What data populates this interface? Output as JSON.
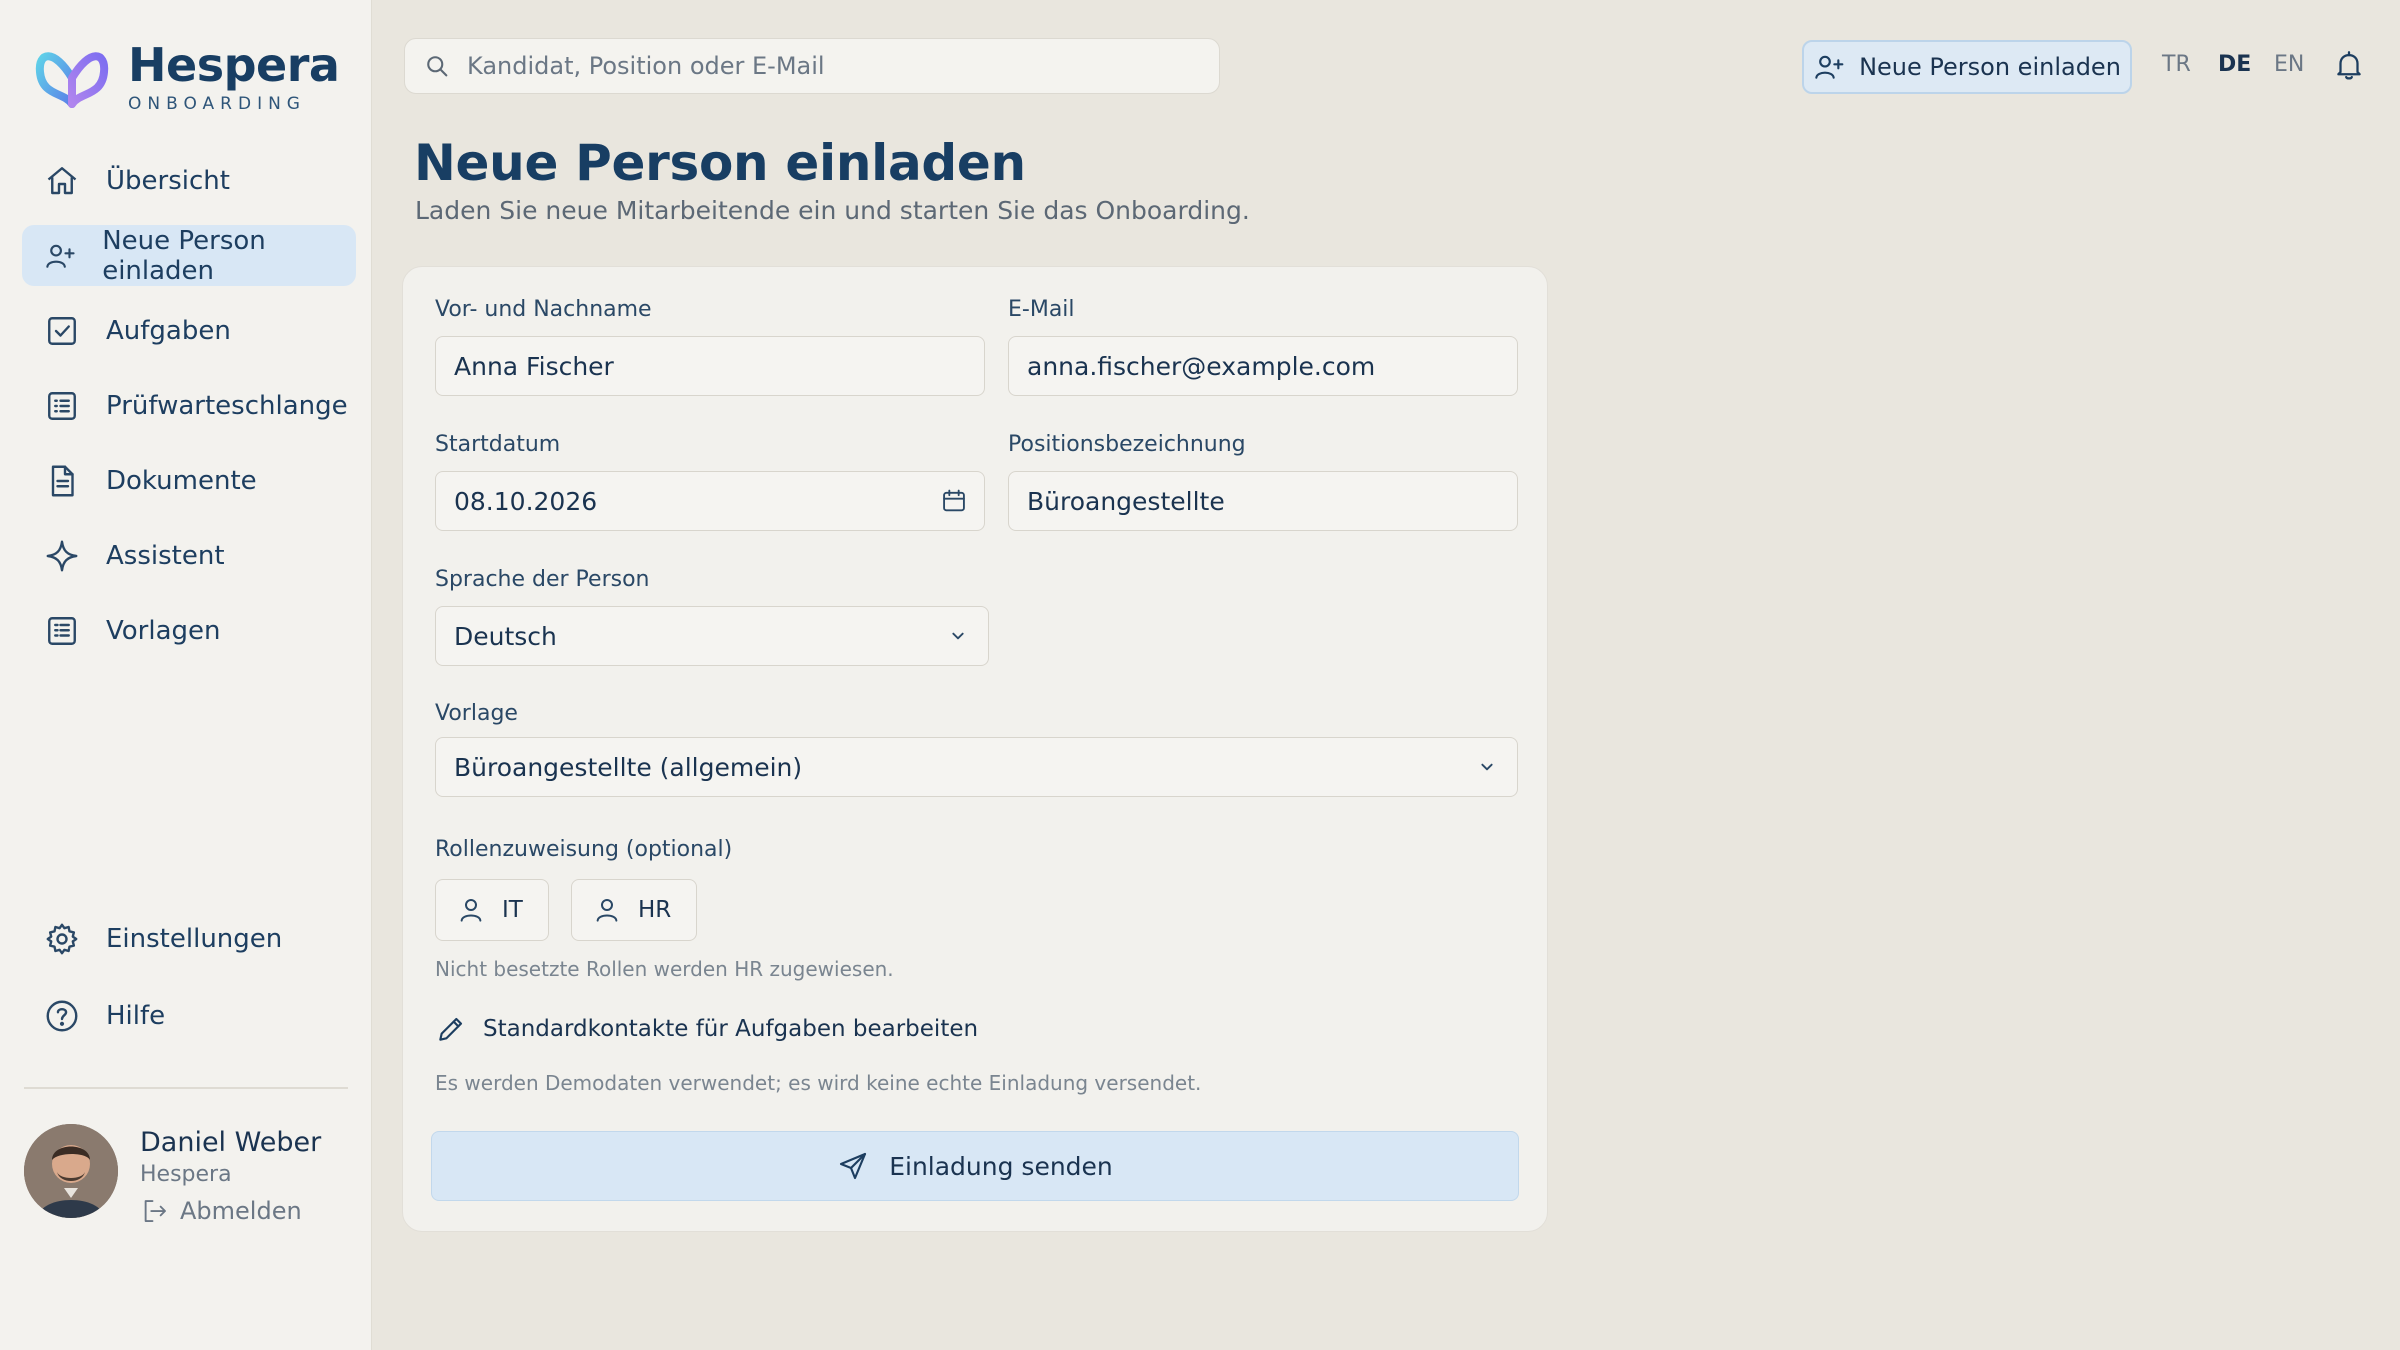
{
  "brand": {
    "name": "Hespera",
    "tagline": "ONBOARDING",
    "logo_icon": "butterfly-logo-icon",
    "colors": {
      "logo_left": "#7fb8f0",
      "logo_right": "#9b7ce8",
      "navy": "#183e63"
    }
  },
  "sidebar": {
    "items": [
      {
        "label": "Übersicht",
        "icon": "home-icon"
      },
      {
        "label": "Neue Person einladen",
        "icon": "user-plus-icon",
        "active": true
      },
      {
        "label": "Aufgaben",
        "icon": "checkbox-icon"
      },
      {
        "label": "Prüfwarteschlange",
        "icon": "list-icon"
      },
      {
        "label": "Dokumente",
        "icon": "document-icon"
      },
      {
        "label": "Assistent",
        "icon": "sparkle-icon"
      },
      {
        "label": "Vorlagen",
        "icon": "template-icon"
      }
    ],
    "bottom_items": [
      {
        "label": "Einstellungen",
        "icon": "gear-icon"
      },
      {
        "label": "Hilfe",
        "icon": "help-icon"
      }
    ],
    "user": {
      "name": "Daniel Weber",
      "org": "Hespera",
      "logout_label": "Abmelden"
    }
  },
  "topbar": {
    "search_placeholder": "Kandidat, Position oder E-Mail",
    "invite_button": "Neue Person einladen",
    "languages": [
      "TR",
      "DE",
      "EN"
    ],
    "active_language": "DE"
  },
  "page": {
    "title": "Neue Person einladen",
    "subtitle": "Laden Sie neue Mitarbeitende ein und starten Sie das Onboarding."
  },
  "form": {
    "name": {
      "label": "Vor- und Nachname",
      "value": "Anna Fischer"
    },
    "email": {
      "label": "E-Mail",
      "value": "anna.fischer@example.com"
    },
    "start_date": {
      "label": "Startdatum",
      "value": "08.10.2026"
    },
    "position": {
      "label": "Positionsbezeichnung",
      "value": "Büroangestellte"
    },
    "language": {
      "label": "Sprache der Person",
      "value": "Deutsch"
    },
    "template": {
      "label": "Vorlage",
      "value": "Büroangestellte (allgemein)"
    },
    "roles": {
      "label": "Rollenzuweisung (optional)",
      "items": [
        "IT",
        "HR"
      ],
      "hint": "Nicht besetzte Rollen werden HR zugewiesen."
    },
    "edit_contacts_link": "Standardkontakte für Aufgaben bearbeiten",
    "demo_notice": "Es werden Demodaten verwendet; es wird keine echte Einladung versendet.",
    "submit_label": "Einladung senden"
  }
}
